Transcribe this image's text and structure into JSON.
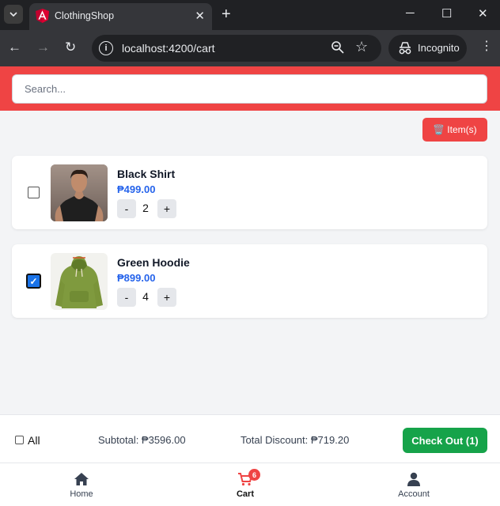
{
  "browser": {
    "tab_title": "ClothingShop",
    "url": "localhost:4200/cart",
    "incognito_label": "Incognito"
  },
  "search": {
    "placeholder": "Search..."
  },
  "delete_button": {
    "label": "Item(s)",
    "icon": "trash-icon"
  },
  "cart_items": [
    {
      "name": "Black Shirt",
      "price": "₱499.00",
      "quantity": "2",
      "selected": false
    },
    {
      "name": "Green Hoodie",
      "price": "₱899.00",
      "quantity": "4",
      "selected": true
    }
  ],
  "qty_controls": {
    "minus": "-",
    "plus": "+"
  },
  "summary": {
    "select_all_label": "All",
    "subtotal": "Subtotal: ₱3596.00",
    "total_discount": "Total Discount: ₱719.20",
    "checkout_label": "Check Out (1)"
  },
  "bottom_nav": {
    "home": "Home",
    "cart": "Cart",
    "cart_badge": "6",
    "account": "Account"
  },
  "colors": {
    "accent_red": "#ef4444",
    "price_blue": "#2563eb",
    "checkout_green": "#16a34a"
  }
}
